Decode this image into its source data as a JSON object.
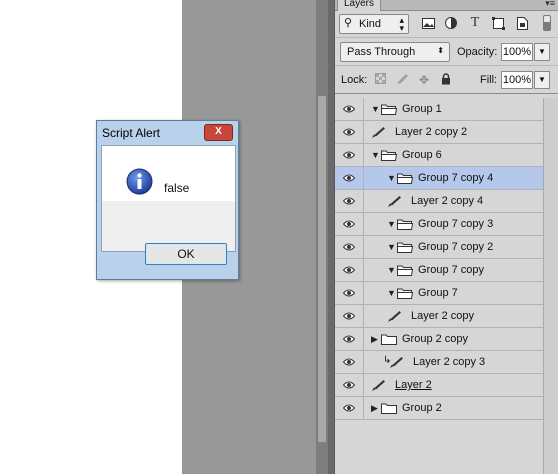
{
  "panel": {
    "tab_label": "Layers",
    "filter": {
      "kind_label": "Kind",
      "icons": [
        "image-filter-icon",
        "adjustment-filter-icon",
        "type-filter-icon",
        "shape-filter-icon",
        "smart-object-filter-icon"
      ]
    },
    "blend_mode": "Pass Through",
    "opacity_label": "Opacity:",
    "opacity_value": "100%",
    "lock_label": "Lock:",
    "fill_label": "Fill:",
    "fill_value": "100%"
  },
  "layers": [
    {
      "name": "Group 1",
      "type": "group",
      "depth": 0,
      "expanded": true
    },
    {
      "name": "Layer 2 copy 2",
      "type": "layer",
      "depth": 0
    },
    {
      "name": "Group 6",
      "type": "group",
      "depth": 0,
      "expanded": true
    },
    {
      "name": "Group 7 copy 4",
      "type": "group",
      "depth": 1,
      "expanded": true,
      "selected": true
    },
    {
      "name": "Layer 2 copy 4",
      "type": "layer",
      "depth": 1
    },
    {
      "name": "Group 7 copy 3",
      "type": "group",
      "depth": 1,
      "expanded": true
    },
    {
      "name": "Group 7 copy 2",
      "type": "group",
      "depth": 1,
      "expanded": true
    },
    {
      "name": "Group 7 copy",
      "type": "group",
      "depth": 1,
      "expanded": true
    },
    {
      "name": "Group 7",
      "type": "group",
      "depth": 1,
      "expanded": true
    },
    {
      "name": "Layer 2 copy",
      "type": "layer",
      "depth": 1
    },
    {
      "name": "Group 2 copy",
      "type": "group",
      "depth": 0,
      "expanded": false
    },
    {
      "name": "Layer 2 copy 3",
      "type": "layer",
      "depth": 1,
      "clipped": true
    },
    {
      "name": "Layer 2",
      "type": "layer",
      "depth": 0,
      "underline": true
    },
    {
      "name": "Group 2",
      "type": "group",
      "depth": 0,
      "expanded": false
    }
  ],
  "dialog": {
    "title": "Script Alert",
    "close_label": "X",
    "message": "false",
    "ok_label": "OK"
  },
  "colors": {
    "selected_row": "#b4c8ec",
    "panel_bg": "#d6d6d6",
    "dialog_frame": "#b9d1ea",
    "close_button": "#c8463a"
  }
}
